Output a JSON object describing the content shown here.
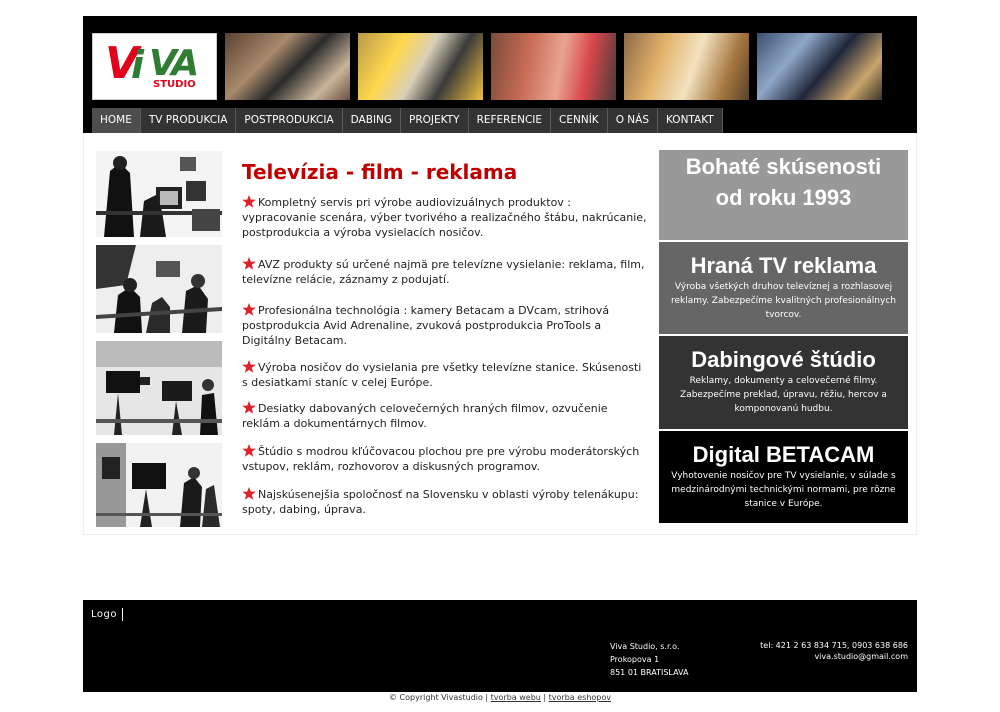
{
  "header": {
    "logo_text": "VIVA STUDIO",
    "photos": [
      "studio-presenters-photo",
      "camera-crew-photo",
      "interview-set-photo",
      "production-room-photo",
      "studio-cameras-photo"
    ]
  },
  "nav": {
    "items": [
      "HOME",
      "TV PRODUKCIA",
      "POSTPRODUKCIA",
      "DABING",
      "PROJEKTY",
      "REFERENCIE",
      "CENNÍK",
      "O NÁS",
      "KONTAKT"
    ],
    "active": "HOME"
  },
  "main": {
    "title": "Televízia - film - reklama",
    "features": [
      "Kompletný servis pri výrobe audiovizuálnych produktov : vypracovanie scenára, výber tvorivého a realizačného štábu, nakrúcanie, postprodukcia a výroba vysielacích nosičov.",
      "AVZ produkty sú určené najmä pre televízne vysielanie: reklama, film, televízne relácie, záznamy z podujatí.",
      "Profesionálna technológia : kamery Betacam a DVcam, strihová postprodukcia Avid Adrenaline, zvuková postprodukcia ProTools a Digitálny Betacam.",
      "Výroba nosičov do vysielania pre všetky televízne stanice. Skúsenosti s desiatkami staníc v celej Európe.",
      "Desiatky dabovaných celovečerných hraných filmov, ozvučenie reklám a dokumentárnych filmov.",
      "Štúdio s modrou kľúčovacou plochou pre pre výrobu moderátorských vstupov, reklám, rozhovorov a diskusných programov.",
      "Najskúsenejšia spoločnosť na Slovensku v oblasti výroby telenákupu: spoty, dabing, úprava."
    ]
  },
  "sidebar": {
    "box1": {
      "line1": "Bohaté skúsenosti",
      "line2": "od roku 1993"
    },
    "box2": {
      "title": "Hraná TV reklama",
      "desc": "Výroba všetkých druhov televíznej a rozhlasovej reklamy. Zabezpečíme kvalitných profesionálnych tvorcov."
    },
    "box3": {
      "title": "Dabingové štúdio",
      "desc": "Reklamy, dokumenty a celovečerné filmy. Zabezpečíme preklad, úpravu, réžiu, hercov a komponovanú hudbu."
    },
    "box4": {
      "title": "Digital BETACAM",
      "desc": "Vyhotovenie nosičov pre TV vysielanie, v súlade s medzinárodnými technickými normami, pre rôzne stanice v Európe."
    }
  },
  "footer": {
    "logo_label": "Logo",
    "address": [
      "Viva Studio, s.r.o.",
      "Prokopova 1",
      "851 01 BRATISLAVA"
    ],
    "phone": "tel: 421 2  63 834 715, 0903   638 686",
    "email": "viva.studio@gmail.com"
  },
  "copyright": {
    "text": "© Copyright Vivastudio | ",
    "link1": "tvorba webu",
    "sep": " | ",
    "link2": "tvorba eshopov"
  }
}
